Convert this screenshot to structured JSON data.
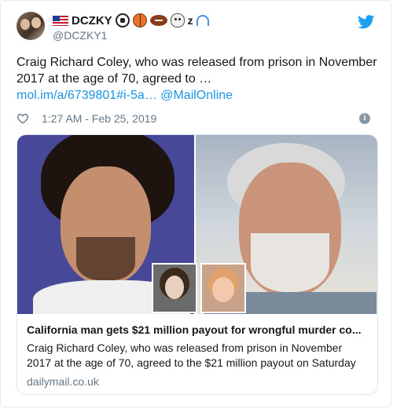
{
  "user": {
    "display_name": "DCZKY",
    "name_suffix": "z",
    "handle": "@DCZKY1",
    "emoji_icons": [
      "us-flag-icon",
      "soccer-ball-icon",
      "basketball-icon",
      "american-football-icon",
      "skull-crossbones-icon",
      "headphones-icon"
    ]
  },
  "tweet": {
    "text": "Craig Richard Coley, who was released from prison in November 2017 at the age of 70, agreed to …",
    "link": "mol.im/a/6739801#i-5a…",
    "mention": "@MailOnline",
    "timestamp": "1:27 AM - Feb 25, 2019"
  },
  "card": {
    "title": "California man gets $21 million payout for wrongful murder co...",
    "description": "Craig Richard Coley, who was released from prison in November 2017 at the age of 70, agreed to the $21 million payout on Saturday",
    "domain": "dailymail.co.uk"
  },
  "colors": {
    "link": "#1b95e0",
    "twitter_blue": "#1da1f2",
    "muted": "#657786"
  }
}
